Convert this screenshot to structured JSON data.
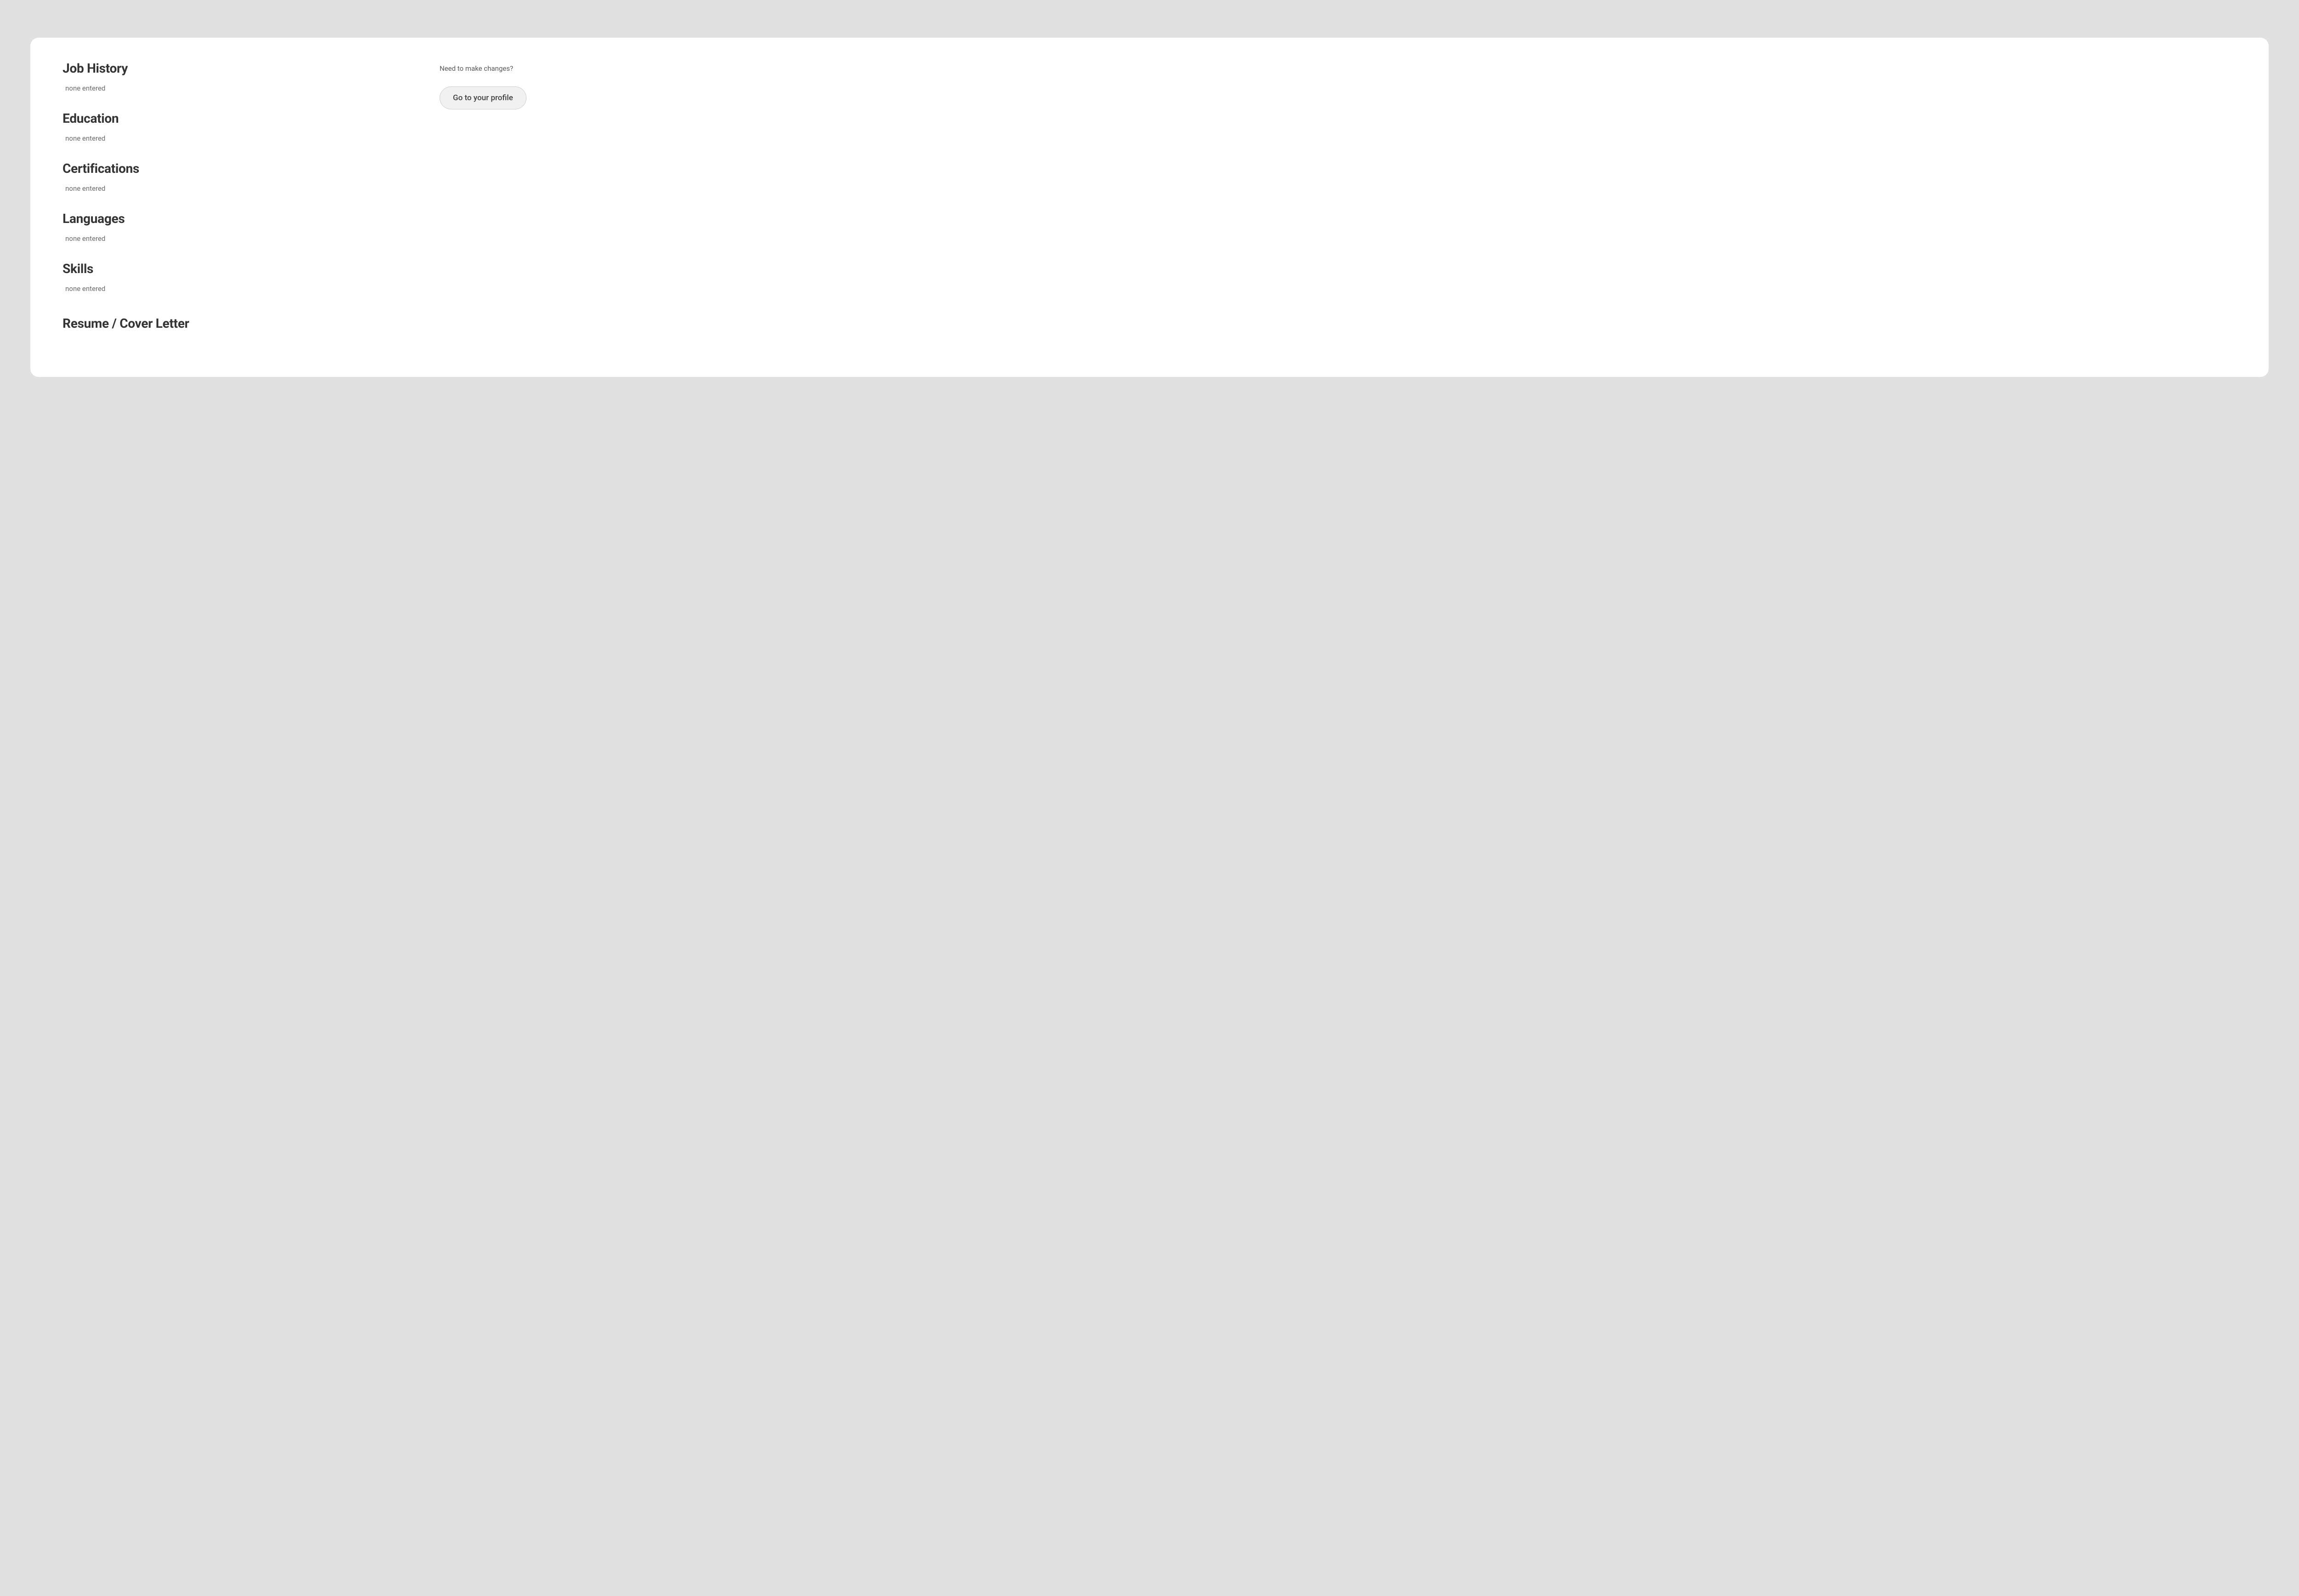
{
  "sections": {
    "job_history": {
      "heading": "Job History",
      "empty": "none entered"
    },
    "education": {
      "heading": "Education",
      "empty": "none entered"
    },
    "certifications": {
      "heading": "Certifications",
      "empty": "none entered"
    },
    "languages": {
      "heading": "Languages",
      "empty": "none entered"
    },
    "skills": {
      "heading": "Skills",
      "empty": "none entered"
    },
    "resume_cover_letter": {
      "heading": "Resume / Cover Letter"
    }
  },
  "sidebar": {
    "prompt": "Need to make changes?",
    "button_label": "Go to your profile"
  }
}
